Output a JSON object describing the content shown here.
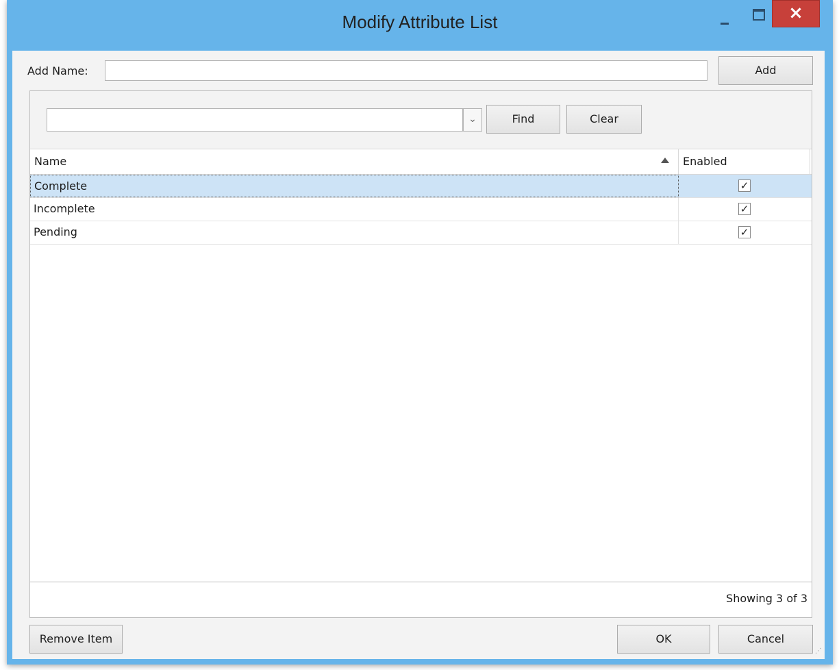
{
  "window": {
    "title": "Modify Attribute List",
    "close_glyph": "×",
    "accent": "#66b4ea",
    "close_color": "#c7403a"
  },
  "add_row": {
    "label": "Add Name:",
    "input_value": "",
    "add_label": "Add"
  },
  "search": {
    "combo_value": "",
    "dropdown_glyph": "⌄",
    "find_label": "Find",
    "clear_label": "Clear"
  },
  "grid": {
    "columns": [
      {
        "label": "Name",
        "sort": "ascending"
      },
      {
        "label": "Enabled"
      }
    ],
    "rows": [
      {
        "name": "Complete",
        "enabled": true,
        "selected": true
      },
      {
        "name": "Incomplete",
        "enabled": true,
        "selected": false
      },
      {
        "name": "Pending",
        "enabled": true,
        "selected": false
      }
    ],
    "check_glyph": "✓",
    "status": "Showing 3 of 3"
  },
  "footer": {
    "remove_label": "Remove Item",
    "ok_label": "OK",
    "cancel_label": "Cancel"
  }
}
